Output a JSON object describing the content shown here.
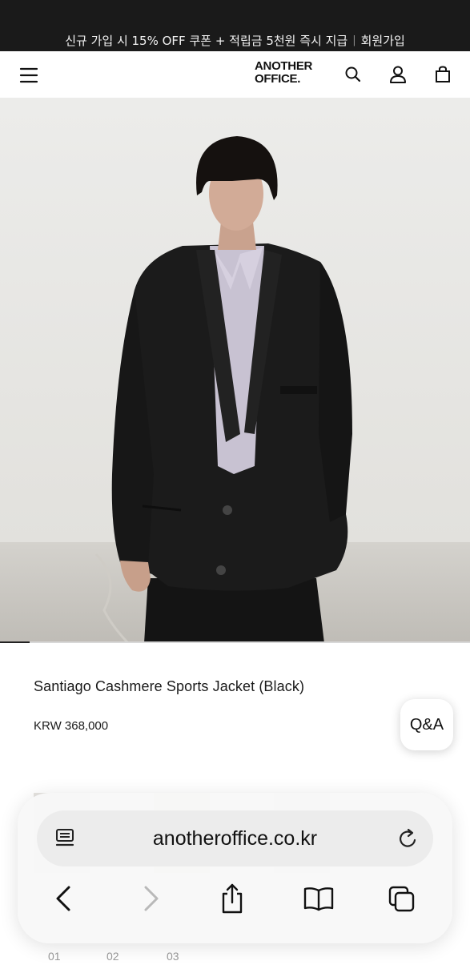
{
  "promo": {
    "text": "신규 가입 시 15% OFF 쿠폰 + 적립금 5천원 즉시 지급",
    "separator": "|",
    "link": "회원가입"
  },
  "header": {
    "brand_line1": "ANOTHER",
    "brand_line2": "OFFICE.",
    "icons": [
      "menu-icon",
      "search-icon",
      "account-icon",
      "bag-icon"
    ]
  },
  "hero": {
    "carousel_progress": 0.0625
  },
  "product": {
    "name": "Santiago Cashmere Sports Jacket (Black)",
    "price": "KRW 368,000"
  },
  "qa_button": {
    "label": "Q&A"
  },
  "thumbnails": {
    "numbers": [
      "01",
      "02",
      "03"
    ]
  },
  "browser": {
    "url": "anotheroffice.co.kr",
    "icons": [
      "page-menu-icon",
      "reload-icon",
      "back-icon",
      "forward-icon",
      "share-icon",
      "bookmarks-icon",
      "tabs-icon"
    ],
    "forward_enabled": false
  }
}
